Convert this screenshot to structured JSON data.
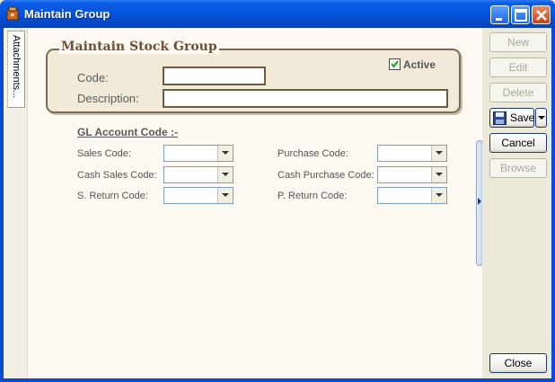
{
  "window": {
    "title": "Maintain Group"
  },
  "side_tab": {
    "label": "Attachments..."
  },
  "group": {
    "title": "Maintain Stock Group",
    "active_label": "Active",
    "active_checked": true,
    "code_label": "Code:",
    "code_value": "",
    "description_label": "Description:",
    "description_value": ""
  },
  "gl": {
    "heading": "GL Account Code :-",
    "fields": [
      {
        "label": "Sales Code:",
        "value": ""
      },
      {
        "label": "Cash Sales Code:",
        "value": ""
      },
      {
        "label": "S. Return Code:",
        "value": ""
      },
      {
        "label": "Purchase Code:",
        "value": ""
      },
      {
        "label": "Cash Purchase Code:",
        "value": ""
      },
      {
        "label": "P. Return Code:",
        "value": ""
      }
    ]
  },
  "actions": {
    "new": "New",
    "edit": "Edit",
    "delete": "Delete",
    "save": "Save",
    "cancel": "Cancel",
    "browse": "Browse",
    "close": "Close"
  },
  "colors": {
    "titlebar": "#0553dd",
    "group_border": "#7b6a53",
    "group_title": "#6b5132",
    "client_bg": "#fdf9f2"
  }
}
